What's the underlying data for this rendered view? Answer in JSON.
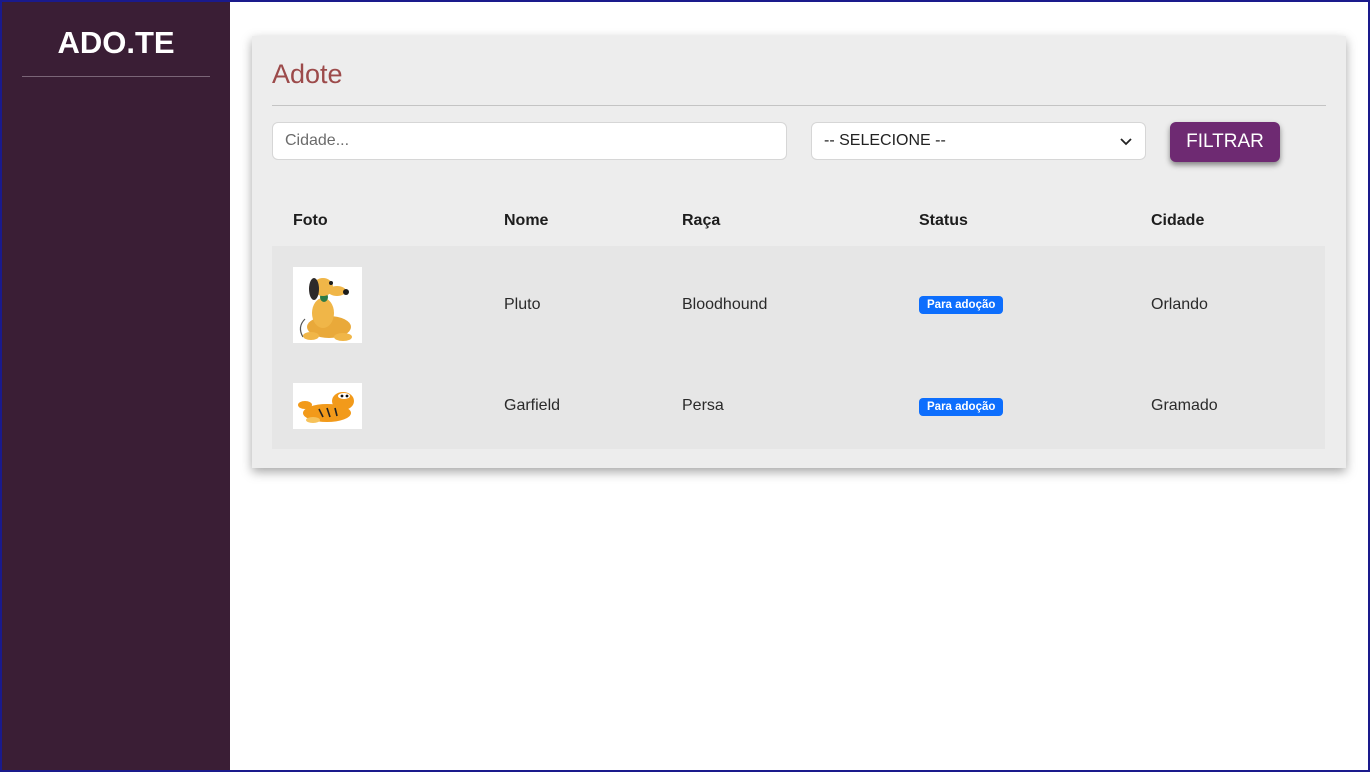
{
  "app": {
    "brand": "ADO.TE"
  },
  "page": {
    "title": "Adote"
  },
  "filters": {
    "city_placeholder": "Cidade...",
    "city_value": "",
    "select_value": "-- SELECIONE --",
    "filter_button": "FILTRAR"
  },
  "table": {
    "headers": [
      "Foto",
      "Nome",
      "Raça",
      "Status",
      "Cidade"
    ],
    "rows": [
      {
        "photo_icon": "pluto-dog-image",
        "name": "Pluto",
        "breed": "Bloodhound",
        "status": "Para adoção",
        "city": "Orlando"
      },
      {
        "photo_icon": "garfield-cat-image",
        "name": "Garfield",
        "breed": "Persa",
        "status": "Para adoção",
        "city": "Gramado"
      }
    ]
  },
  "colors": {
    "sidebar": "#3a1e35",
    "title": "#9c4a4a",
    "button": "#6e2a72",
    "badge": "#0d6efd",
    "frame_border": "#1a1a8c"
  }
}
